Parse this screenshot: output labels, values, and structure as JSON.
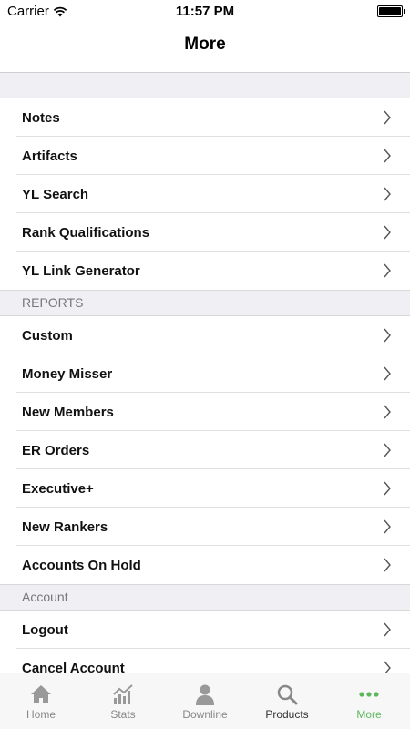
{
  "status_bar": {
    "carrier": "Carrier",
    "time": "11:57 PM"
  },
  "header": {
    "title": "More"
  },
  "groups": [
    {
      "header": "",
      "items": [
        {
          "label": "Notes"
        },
        {
          "label": "Artifacts"
        },
        {
          "label": "YL Search"
        },
        {
          "label": "Rank Qualifications"
        },
        {
          "label": "YL Link Generator"
        }
      ]
    },
    {
      "header": "REPORTS",
      "items": [
        {
          "label": "Custom"
        },
        {
          "label": "Money Misser"
        },
        {
          "label": "New Members"
        },
        {
          "label": "ER Orders"
        },
        {
          "label": "Executive+"
        },
        {
          "label": "New Rankers"
        },
        {
          "label": "Accounts On Hold"
        }
      ]
    },
    {
      "header": "Account",
      "items": [
        {
          "label": "Logout"
        },
        {
          "label": "Cancel Account"
        }
      ]
    }
  ],
  "tab_bar": {
    "tabs": [
      {
        "label": "Home",
        "icon": "home-icon"
      },
      {
        "label": "Stats",
        "icon": "stats-icon"
      },
      {
        "label": "Downline",
        "icon": "person-icon"
      },
      {
        "label": "Products",
        "icon": "search-icon"
      },
      {
        "label": "More",
        "icon": "more-dots-icon",
        "active": true
      }
    ]
  },
  "colors": {
    "accent": "#5cb85c",
    "group_background": "#efeff4",
    "icon_gray": "#999999"
  }
}
